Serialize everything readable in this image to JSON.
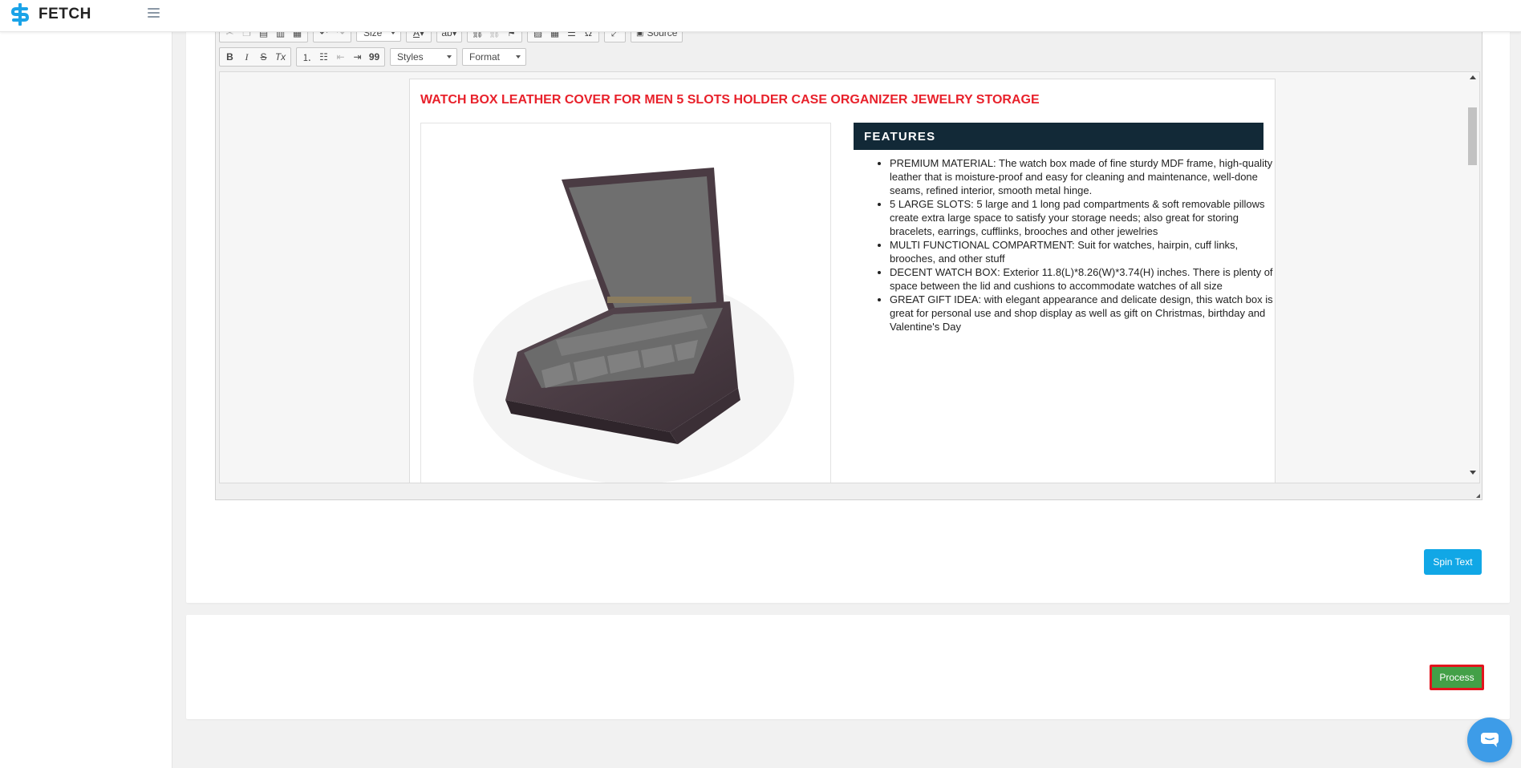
{
  "header": {
    "brand": "FETCH",
    "logo_icon": "fetch-s-logo-icon",
    "menu_icon": "hamburger-icon"
  },
  "editor": {
    "toolbar_row1": {
      "icons": [
        "cut-icon",
        "copy-icon",
        "paste-icon",
        "paste-text-icon",
        "paste-word-icon",
        "undo-icon",
        "redo-icon",
        "text-color-icon",
        "spellcheck-icon",
        "link-icon",
        "unlink-icon",
        "anchor-icon",
        "image-icon",
        "table-icon",
        "horizontal-rule-icon",
        "special-char-icon",
        "maximize-icon"
      ],
      "size_label": "Size",
      "source_label": "Source"
    },
    "toolbar_row2": {
      "bold": "B",
      "italic": "I",
      "strike": "S",
      "remove_format": "Tx",
      "blockquote": "99",
      "styles_label": "Styles",
      "format_label": "Format"
    },
    "content": {
      "title": "WATCH BOX LEATHER COVER FOR MEN 5 SLOTS HOLDER CASE ORGANIZER JEWELRY STORAGE",
      "image": "watch-box-product-image",
      "features_heading": "FEATURES",
      "features": [
        "PREMIUM MATERIAL: The watch box made of fine sturdy MDF frame, high-quality leather that is moisture-proof and easy for cleaning and maintenance, well-done seams, refined interior, smooth metal hinge.",
        "5 LARGE SLOTS: 5 large and 1 long pad compartments & soft removable pillows create extra large space to satisfy your storage needs; also great for storing bracelets, earrings, cufflinks, brooches and other jewelries",
        "MULTI FUNCTIONAL COMPARTMENT: Suit for watches, hairpin, cuff links, brooches, and other stuff",
        "DECENT WATCH BOX: Exterior 11.8(L)*8.26(W)*3.74(H) inches. There is plenty of space between the lid and cushions to accommodate watches of all size",
        "GREAT GIFT IDEA: with elegant appearance and delicate design, this watch box is great for personal use and shop display as well as gift on Christmas, birthday and Valentine's Day"
      ]
    }
  },
  "buttons": {
    "spin_text": "Spin Text",
    "process": "Process"
  },
  "colors": {
    "brand_blue": "#1aa3e8",
    "title_red": "#e8212b",
    "features_bar": "#122937",
    "spin_button": "#11a7e6",
    "process_button": "#43a047",
    "process_highlight": "#e2141d"
  },
  "chat_icon": "chat-bubble-icon"
}
